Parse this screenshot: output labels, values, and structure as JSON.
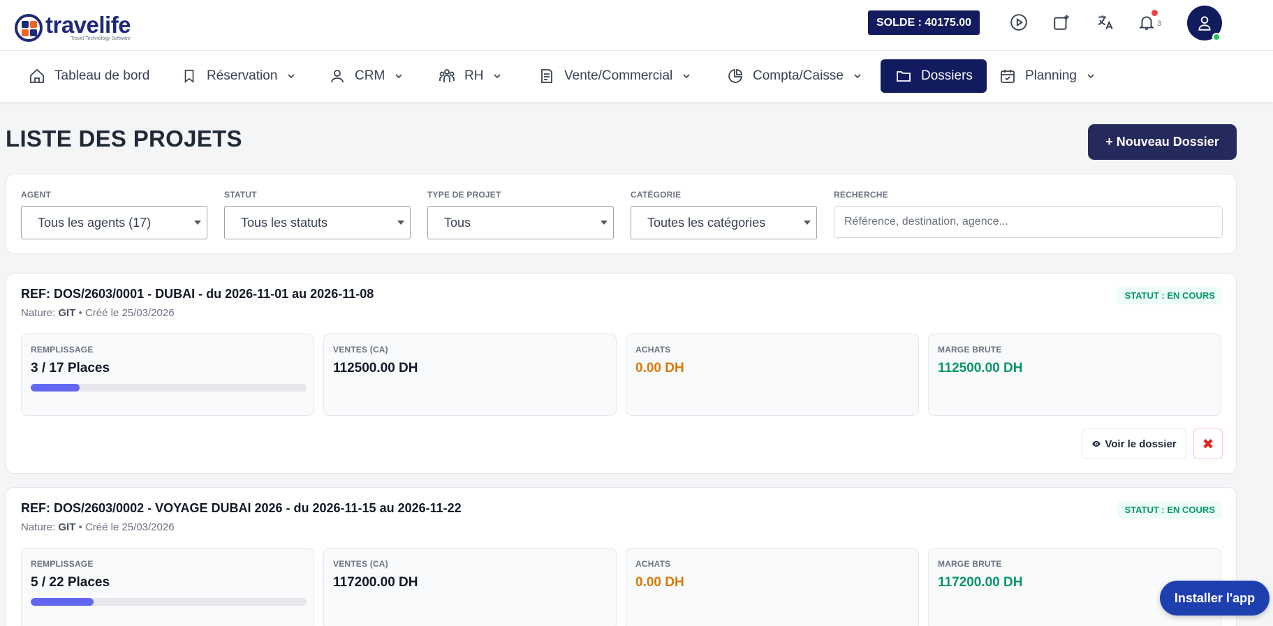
{
  "header": {
    "logo_text": "travelife",
    "logo_tagline": "Travel Technology Software",
    "solde_label": "SOLDE : 40175.00",
    "notification_count": "3"
  },
  "nav": {
    "items": [
      {
        "label": "Tableau de bord",
        "icon": "home-icon",
        "dropdown": false
      },
      {
        "label": "Réservation",
        "icon": "bookmark-icon",
        "dropdown": true
      },
      {
        "label": "CRM",
        "icon": "user-icon",
        "dropdown": true
      },
      {
        "label": "RH",
        "icon": "users-icon",
        "dropdown": true
      },
      {
        "label": "Vente/Commercial",
        "icon": "document-icon",
        "dropdown": true
      },
      {
        "label": "Compta/Caisse",
        "icon": "pie-chart-icon",
        "dropdown": true
      },
      {
        "label": "Dossiers",
        "icon": "folder-icon",
        "dropdown": false,
        "active": true
      },
      {
        "label": "Planning",
        "icon": "calendar-icon",
        "dropdown": true
      }
    ]
  },
  "page": {
    "title": "LISTE DES PROJETS",
    "new_button": "+ Nouveau Dossier"
  },
  "filters": {
    "agent": {
      "label": "AGENT",
      "value": "Tous les agents (17)"
    },
    "statut": {
      "label": "STATUT",
      "value": "Tous les statuts"
    },
    "type": {
      "label": "TYPE DE PROJET",
      "value": "Tous"
    },
    "categorie": {
      "label": "CATÉGORIE",
      "value": "Toutes les catégories"
    },
    "recherche": {
      "label": "RECHERCHE",
      "placeholder": "Référence, destination, agence..."
    }
  },
  "projects": [
    {
      "title": "REF: DOS/2603/0001 - DUBAI - du 2026-11-01 au 2026-11-08",
      "nature_label": "Nature: ",
      "nature": "GIT",
      "created": " • Créé le 25/03/2026",
      "status": "STATUT : EN COURS",
      "remplissage_label": "REMPLISSAGE",
      "remplissage": "3 / 17 Places",
      "fill_fraction": 0.176,
      "ventes_label": "VENTES (CA)",
      "ventes": "112500.00 DH",
      "achats_label": "ACHATS",
      "achats": "0.00 DH",
      "marge_label": "MARGE BRUTE",
      "marge": "112500.00 DH",
      "view_label": "Voir le dossier",
      "delete_label": "✖"
    },
    {
      "title": "REF: DOS/2603/0002 - VOYAGE DUBAI 2026 - du 2026-11-15 au 2026-11-22",
      "nature_label": "Nature: ",
      "nature": "GIT",
      "created": " • Créé le 25/03/2026",
      "status": "STATUT : EN COURS",
      "remplissage_label": "REMPLISSAGE",
      "remplissage": "5 / 22 Places",
      "fill_fraction": 0.227,
      "ventes_label": "VENTES (CA)",
      "ventes": "117200.00 DH",
      "achats_label": "ACHATS",
      "achats": "0.00 DH",
      "marge_label": "MARGE BRUTE",
      "marge": "117200.00 DH"
    }
  ],
  "install_button": "Installer l'app"
}
